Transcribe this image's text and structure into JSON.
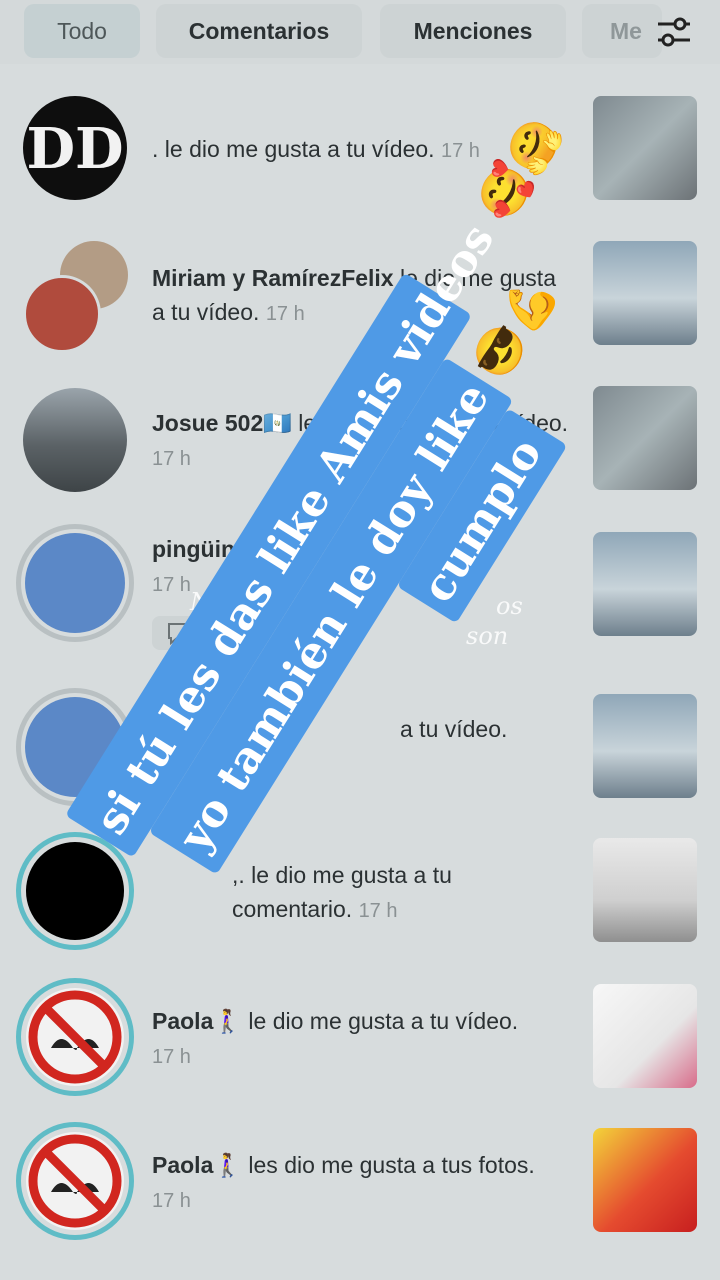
{
  "tabs": [
    "Todo",
    "Comentarios",
    "Menciones",
    "Me"
  ],
  "notifications": [
    {
      "name": "",
      "text": ". le dio me gusta a tu vídeo.",
      "time": "17 h"
    },
    {
      "name": "Miriam y RamírezFelix",
      "text": " le dio me gusta a tu vídeo.",
      "time": "17 h"
    },
    {
      "name": "Josue 502🇬🇹",
      "text": " le dio me gusta a tu vídeo.",
      "time": "17 h"
    },
    {
      "name": "pingüino",
      "text": "",
      "time": "17 h"
    },
    {
      "name": "",
      "text": "a tu vídeo.",
      "time": ""
    },
    {
      "name": "",
      "text": ",. le dio me gusta a tu comentario.",
      "time": "17 h"
    },
    {
      "name": "Paola🚶‍♀️",
      "text": " le dio me gusta a tu vídeo.",
      "time": "17 h"
    },
    {
      "name": "Paola🚶‍♀️",
      "text": " les dio me gusta a tus fotos.",
      "time": "17 h"
    }
  ],
  "overlay": {
    "line1": "si tú les das like Amis videos 🥰🤗",
    "line2": "yo también le doy like 😎💪",
    "line3": "cumplo",
    "ghost_left": "No",
    "ghost_right": "os",
    "ghost_right2": "son"
  },
  "colors": {
    "overlay_band": "#4f9ae6",
    "ring": "#5fbcc6",
    "background": "#d7dcdd"
  }
}
